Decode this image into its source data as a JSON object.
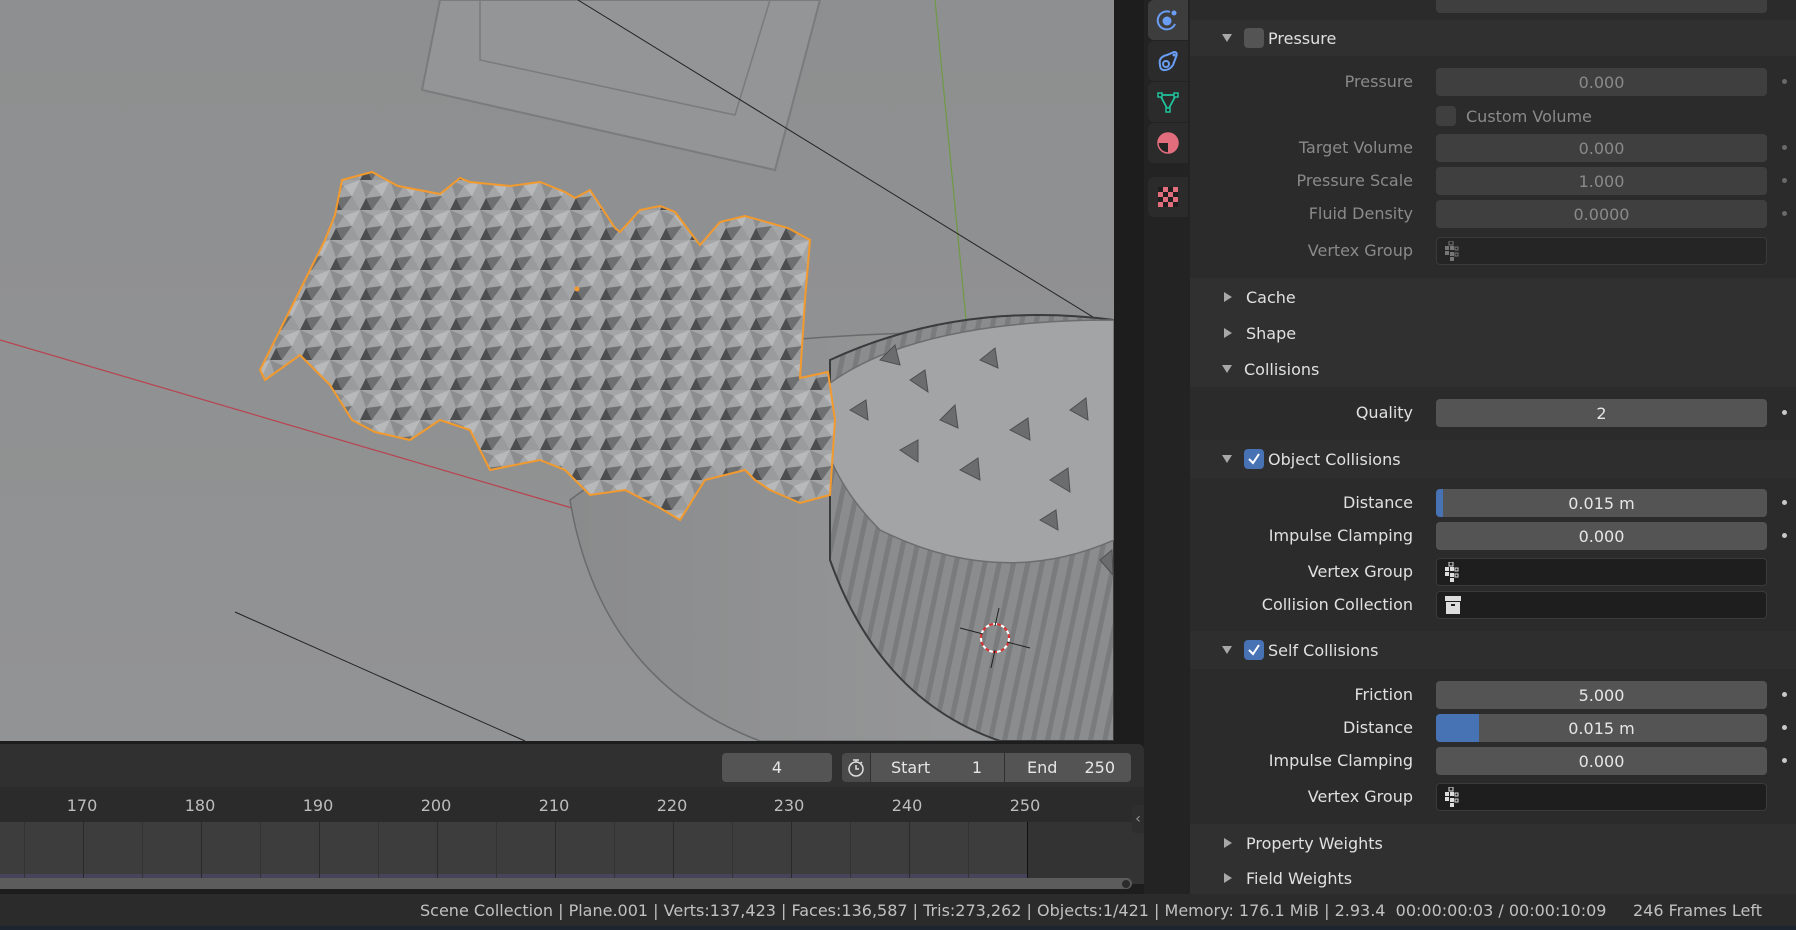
{
  "viewport": {
    "selected_object": "Plane.001",
    "selection_color": "#f29a2e"
  },
  "timeline": {
    "current_frame": "4",
    "start_label": "Start",
    "start_value": "1",
    "end_label": "End",
    "end_value": "250",
    "ruler_ticks": [
      "170",
      "180",
      "190",
      "200",
      "210",
      "220",
      "230",
      "240",
      "250"
    ]
  },
  "property_tabs": [
    {
      "name": "physics-tab",
      "icon": "physics-icon",
      "color": "#6a9ef5",
      "active": true
    },
    {
      "name": "constraints-tab",
      "icon": "object-constraint-icon",
      "color": "#6a9ef5",
      "active": false
    },
    {
      "name": "object-data-tab",
      "icon": "mesh-data-icon",
      "color": "#20c29a",
      "active": false
    },
    {
      "name": "material-tab",
      "icon": "material-icon",
      "color": "#e26d7c",
      "active": false
    },
    {
      "name": "texture-tab",
      "icon": "texture-icon",
      "color": "#e26d7c",
      "active": false
    }
  ],
  "properties": {
    "pressure_panel": {
      "title": "Pressure",
      "enabled": false,
      "fields": {
        "pressure": {
          "label": "Pressure",
          "value": "0.000"
        },
        "custom_volume": {
          "label": "Custom Volume",
          "checked": false
        },
        "target_volume": {
          "label": "Target Volume",
          "value": "0.000"
        },
        "pressure_scale": {
          "label": "Pressure Scale",
          "value": "1.000"
        },
        "fluid_density": {
          "label": "Fluid Density",
          "value": "0.0000"
        },
        "vertex_group": {
          "label": "Vertex Group",
          "value": ""
        }
      }
    },
    "cache_panel": {
      "title": "Cache",
      "expanded": false
    },
    "shape_panel": {
      "title": "Shape",
      "expanded": false
    },
    "collisions_panel": {
      "title": "Collisions",
      "expanded": true,
      "quality": {
        "label": "Quality",
        "value": "2"
      },
      "object_collisions": {
        "title": "Object Collisions",
        "enabled": true,
        "distance": {
          "label": "Distance",
          "value": "0.015 m",
          "fill_fraction": 0.003
        },
        "impulse_clamping": {
          "label": "Impulse Clamping",
          "value": "0.000"
        },
        "vertex_group": {
          "label": "Vertex Group",
          "value": ""
        },
        "collision_collection": {
          "label": "Collision Collection",
          "value": ""
        }
      },
      "self_collisions": {
        "title": "Self Collisions",
        "enabled": true,
        "friction": {
          "label": "Friction",
          "value": "5.000"
        },
        "distance": {
          "label": "Distance",
          "value": "0.015 m",
          "fill_fraction": 0.13
        },
        "impulse_clamping": {
          "label": "Impulse Clamping",
          "value": "0.000"
        },
        "vertex_group": {
          "label": "Vertex Group",
          "value": ""
        }
      }
    },
    "property_weights_panel": {
      "title": "Property Weights",
      "expanded": false
    },
    "field_weights_panel": {
      "title": "Field Weights",
      "expanded": false
    }
  },
  "status_bar": {
    "stats": "Scene Collection | Plane.001 | Verts:137,423 | Faces:136,587 | Tris:273,262 | Objects:1/421 | Memory: 176.1 MiB | 2.93.4  00:00:00:03 / 00:00:10:09",
    "frames_left": "246 Frames Left"
  }
}
